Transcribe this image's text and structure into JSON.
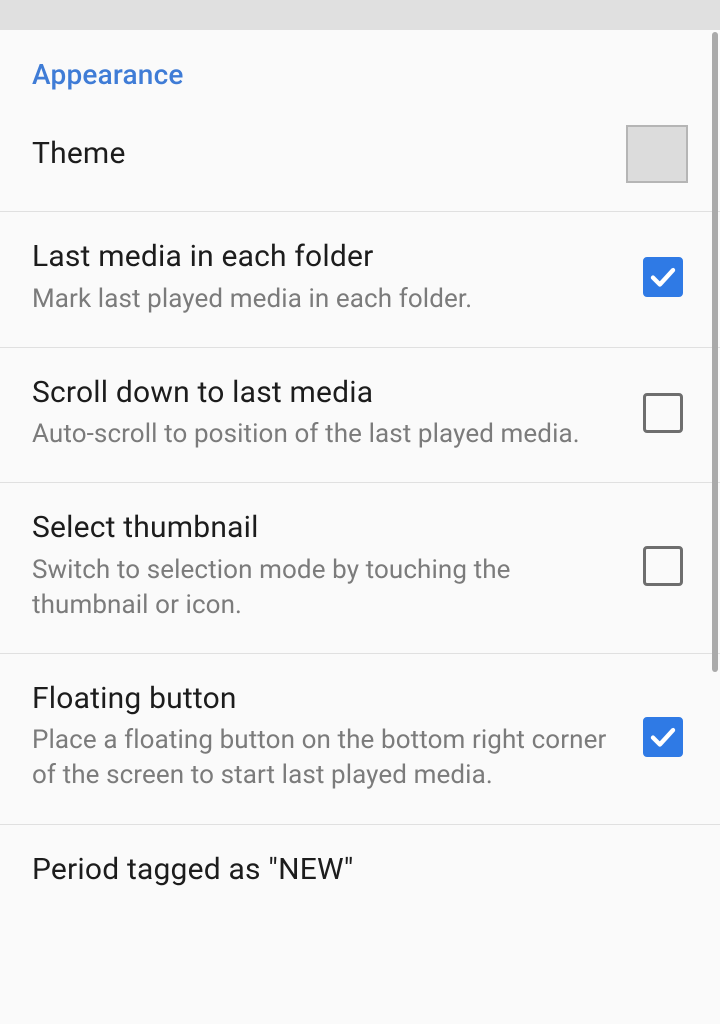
{
  "section": {
    "title": "Appearance"
  },
  "settings": {
    "theme": {
      "title": "Theme"
    },
    "lastMedia": {
      "title": "Last media in each folder",
      "desc": "Mark last played media in each folder.",
      "checked": true
    },
    "scrollDown": {
      "title": "Scroll down to last media",
      "desc": "Auto-scroll to position of the last played media.",
      "checked": false
    },
    "selectThumbnail": {
      "title": "Select thumbnail",
      "desc": "Switch to selection mode by touching the thumbnail or icon.",
      "checked": false
    },
    "floatingButton": {
      "title": "Floating button",
      "desc": "Place a floating button on the bottom right corner of the screen to start last played media.",
      "checked": true
    },
    "periodNew": {
      "title": "Period tagged as \"NEW\""
    }
  }
}
